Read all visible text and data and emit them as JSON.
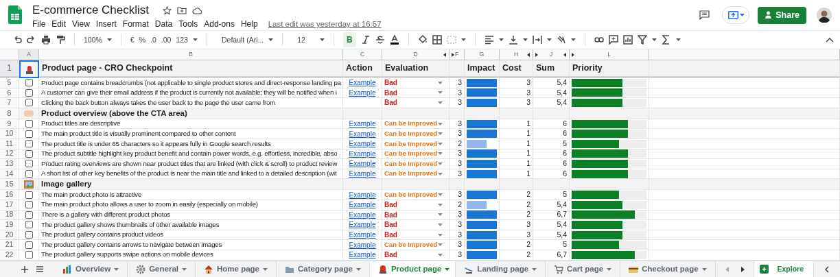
{
  "document": {
    "title": "E-commerce Checklist",
    "menu": [
      "File",
      "Edit",
      "View",
      "Insert",
      "Format",
      "Data",
      "Tools",
      "Add-ons",
      "Help"
    ],
    "last_edit": "Last edit was yesterday at 16:57"
  },
  "share_button": "Share",
  "toolbar": {
    "zoom": "100%",
    "currency": "€",
    "percent": "%",
    "decrease_decimals": ".0",
    "increase_decimals": ".00",
    "number_format": "123",
    "font": "Default (Ari...",
    "font_size": "12",
    "bold": {
      "label": "B",
      "on": true
    }
  },
  "columns": [
    "A",
    "B",
    "C",
    "D",
    "F",
    "G",
    "H",
    "J",
    "L"
  ],
  "header_row": {
    "number": "1",
    "title": "Product page - CRO Checkpoint",
    "action": "Action",
    "evaluation": "Evaluation",
    "impact": "Impact",
    "cost": "Cost",
    "sum": "Sum",
    "priority": "Priority"
  },
  "rows": [
    {
      "kind": "item",
      "number": "5",
      "checked": false,
      "text": "Product page contains breadcrumbs (not applicable to single product stores and direct-response landing pa",
      "action": "Example",
      "evaluation": {
        "text": "Bad",
        "kind": "bad"
      },
      "impact": {
        "value": "3",
        "level": 1
      },
      "cost": "3",
      "sum": "5,4",
      "priority": {
        "level": 0.68
      }
    },
    {
      "kind": "item",
      "number": "6",
      "checked": false,
      "text": "A customer can give their email address if the product is currently not available; they will be notified when i",
      "action": "Example",
      "evaluation": {
        "text": "Bad",
        "kind": "bad"
      },
      "impact": {
        "value": "3",
        "level": 1
      },
      "cost": "3",
      "sum": "5,4",
      "priority": {
        "level": 0.68
      }
    },
    {
      "kind": "item",
      "number": "7",
      "checked": false,
      "text": "Clicking the back button always takes the user back to the page the user came from",
      "evaluation": {
        "text": "Bad",
        "kind": "bad"
      },
      "impact": {
        "value": "3",
        "level": 1
      },
      "cost": "3",
      "sum": "5,4",
      "priority": {
        "level": 0.68
      }
    },
    {
      "kind": "section",
      "number": "8",
      "title": "Product overview (above the CTA area)"
    },
    {
      "kind": "item",
      "number": "9",
      "checked": false,
      "text": "Product titles are descriptive",
      "action": "Example",
      "evaluation": {
        "text": "Can be Improved",
        "kind": "improve"
      },
      "impact": {
        "value": "3",
        "level": 1
      },
      "cost": "1",
      "sum": "6",
      "priority": {
        "level": 0.75
      }
    },
    {
      "kind": "item",
      "number": "10",
      "checked": false,
      "text": "The main product title is visually prominent compared to other content",
      "action": "Example",
      "evaluation": {
        "text": "Can be Improved",
        "kind": "improve"
      },
      "impact": {
        "value": "3",
        "level": 1
      },
      "cost": "1",
      "sum": "6",
      "priority": {
        "level": 0.75
      }
    },
    {
      "kind": "item",
      "number": "11",
      "checked": false,
      "text": "The product title is under 65 characters so it appears fully in Google search results",
      "action": "Example",
      "evaluation": {
        "text": "Can be Improved",
        "kind": "improve"
      },
      "impact": {
        "value": "2",
        "level": 0.66
      },
      "cost": "1",
      "sum": "5",
      "priority": {
        "level": 0.63
      }
    },
    {
      "kind": "item",
      "number": "12",
      "checked": false,
      "text": "The product subtitle highlight key product benefit and contain power words, e.g. effortless, incredible, abso",
      "action": "Example",
      "evaluation": {
        "text": "Can be Improved",
        "kind": "improve"
      },
      "impact": {
        "value": "3",
        "level": 1
      },
      "cost": "1",
      "sum": "6",
      "priority": {
        "level": 0.75
      }
    },
    {
      "kind": "item",
      "number": "13",
      "checked": false,
      "text": "Product rating overviews are shown near product titles that are linked (with click & scroll) to product review",
      "action": "Example",
      "evaluation": {
        "text": "Can be Improved",
        "kind": "improve"
      },
      "impact": {
        "value": "3",
        "level": 1
      },
      "cost": "1",
      "sum": "6",
      "priority": {
        "level": 0.75
      }
    },
    {
      "kind": "item",
      "number": "14",
      "checked": false,
      "text": "A short list of other key benefits of the product is near the main title and linked to a detailed description (wit",
      "action": "Example",
      "evaluation": {
        "text": "Can be Improved",
        "kind": "improve"
      },
      "impact": {
        "value": "3",
        "level": 1
      },
      "cost": "1",
      "sum": "6",
      "priority": {
        "level": 0.75
      }
    },
    {
      "kind": "section",
      "number": "15",
      "title": "Image gallery"
    },
    {
      "kind": "item",
      "number": "16",
      "checked": false,
      "text": "The main product photo is attractive",
      "action": "Example",
      "evaluation": {
        "text": "Can be Improved",
        "kind": "improve"
      },
      "impact": {
        "value": "3",
        "level": 1
      },
      "cost": "2",
      "sum": "5",
      "priority": {
        "level": 0.63
      }
    },
    {
      "kind": "item",
      "number": "17",
      "checked": false,
      "text": "The main product photo allows a user to zoom in easily (especially on mobile)",
      "action": "Example",
      "evaluation": {
        "text": "Bad",
        "kind": "bad"
      },
      "impact": {
        "value": "2",
        "level": 0.66
      },
      "cost": "2",
      "sum": "5,4",
      "priority": {
        "level": 0.68
      }
    },
    {
      "kind": "item",
      "number": "18",
      "checked": false,
      "text": "There is a gallery with different product photos",
      "action": "Example",
      "evaluation": {
        "text": "Bad",
        "kind": "bad"
      },
      "impact": {
        "value": "3",
        "level": 1
      },
      "cost": "2",
      "sum": "6,7",
      "priority": {
        "level": 0.84
      }
    },
    {
      "kind": "item",
      "number": "19",
      "checked": false,
      "text": "The product gallery shows thumbnails of other available images",
      "action": "Example",
      "evaluation": {
        "text": "Bad",
        "kind": "bad"
      },
      "impact": {
        "value": "3",
        "level": 1
      },
      "cost": "3",
      "sum": "5,4",
      "priority": {
        "level": 0.68
      }
    },
    {
      "kind": "item",
      "number": "20",
      "checked": false,
      "text": "The product gallery contains product videos",
      "action": "Example",
      "evaluation": {
        "text": "Bad",
        "kind": "bad"
      },
      "impact": {
        "value": "3",
        "level": 1
      },
      "cost": "3",
      "sum": "5,4",
      "priority": {
        "level": 0.68
      }
    },
    {
      "kind": "item",
      "number": "21",
      "checked": false,
      "text": "The product gallery contains arrows to navigate between images",
      "action": "Example",
      "evaluation": {
        "text": "Can be Improved",
        "kind": "improve"
      },
      "impact": {
        "value": "3",
        "level": 1
      },
      "cost": "2",
      "sum": "5",
      "priority": {
        "level": 0.63
      }
    },
    {
      "kind": "item",
      "number": "22",
      "checked": false,
      "text": "The product gallery supports swipe actions on mobile devices",
      "action": "Example",
      "evaluation": {
        "text": "Bad",
        "kind": "bad"
      },
      "impact": {
        "value": "3",
        "level": 1
      },
      "cost": "2",
      "sum": "6,7",
      "priority": {
        "level": 0.84
      }
    }
  ],
  "sheet_tabs": [
    {
      "label": "Overview",
      "selected": false
    },
    {
      "label": "General",
      "selected": false
    },
    {
      "label": "Home page",
      "selected": false
    },
    {
      "label": "Category page",
      "selected": false
    },
    {
      "label": "Product page",
      "selected": true
    },
    {
      "label": "Landing page",
      "selected": false
    },
    {
      "label": "Cart page",
      "selected": false
    },
    {
      "label": "Checkout page",
      "selected": false
    }
  ],
  "explore_button": "Explore"
}
